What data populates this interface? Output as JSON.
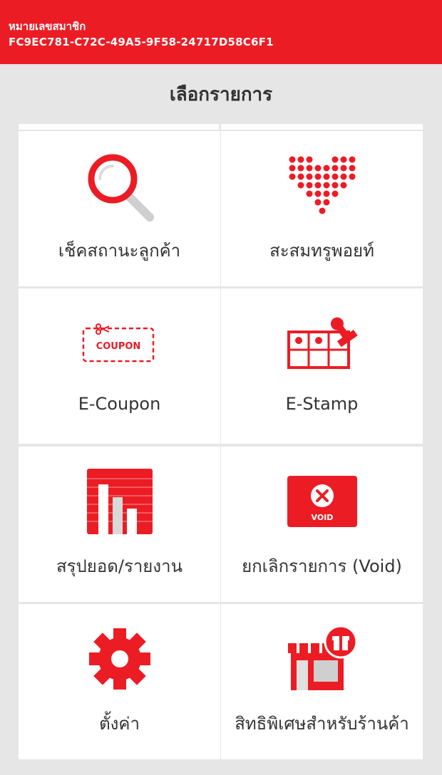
{
  "header": {
    "member_label": "หมายเลขสมาชิก",
    "member_id": "FC9EC781-C72C-49A5-9F58-24717D58C6F1"
  },
  "page_title": "เลือกรายการ",
  "menu": [
    {
      "label": "เช็คสถานะลูกค้า",
      "icon": "magnifier-icon"
    },
    {
      "label": "สะสมทรูพอยท์",
      "icon": "heart-dots-icon"
    },
    {
      "label": "E-Coupon",
      "icon": "coupon-icon",
      "icon_text": "COUPON"
    },
    {
      "label": "E-Stamp",
      "icon": "stamp-card-icon"
    },
    {
      "label": "สรุปยอด/รายงาน",
      "icon": "bar-report-icon"
    },
    {
      "label": "ยกเลิกรายการ (Void)",
      "icon": "void-icon",
      "icon_text": "VOID"
    },
    {
      "label": "ตั้งค่า",
      "icon": "gear-icon"
    },
    {
      "label": "สิทธิพิเศษสำหรับร้านค้า",
      "icon": "shop-gift-icon"
    }
  ],
  "colors": {
    "accent": "#ec1c24",
    "background": "#e6e6e6",
    "tile": "#ffffff",
    "text": "#333333"
  }
}
